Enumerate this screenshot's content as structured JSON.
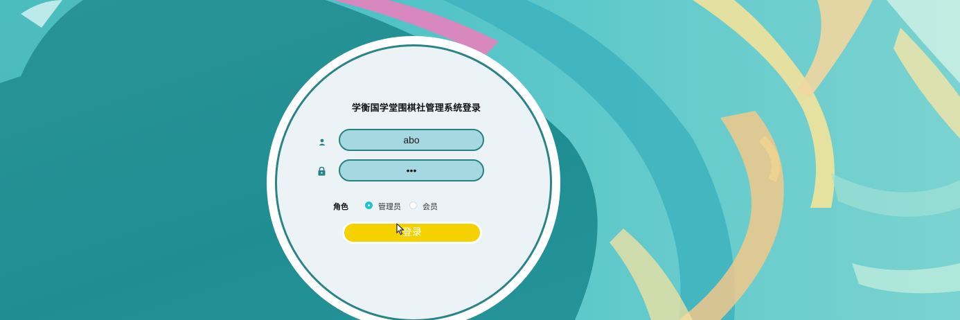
{
  "page": {
    "title": "学衡国学堂围棋社管理系统登录"
  },
  "login_form": {
    "username_value": "abo",
    "password_value": "•••",
    "role_label": "角色",
    "roles": [
      {
        "label": "管理员",
        "selected": true
      },
      {
        "label": "会员",
        "selected": false
      }
    ],
    "submit_label": "登录"
  },
  "icons": {
    "username": "user-icon",
    "password": "lock-icon",
    "pointer": "mouse-cursor-icon"
  },
  "colors": {
    "accent_teal": "#2a7f85",
    "field_fill": "#a6d8e1",
    "button_yellow": "#f6d100",
    "radio_selected": "#1fc2d0"
  }
}
